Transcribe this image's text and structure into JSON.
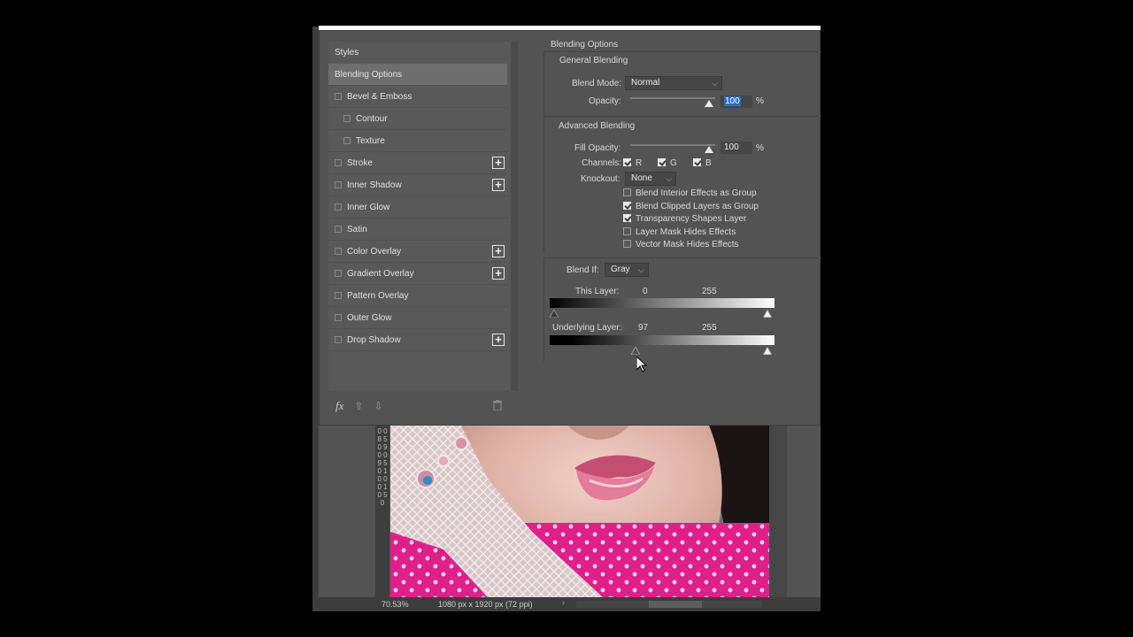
{
  "styles_panel": {
    "header": "Styles",
    "selected": "Blending Options",
    "items": [
      {
        "label": "Bevel & Emboss",
        "sub": false,
        "plus": false
      },
      {
        "label": "Contour",
        "sub": true,
        "plus": false
      },
      {
        "label": "Texture",
        "sub": true,
        "plus": false
      },
      {
        "label": "Stroke",
        "sub": false,
        "plus": true
      },
      {
        "label": "Inner Shadow",
        "sub": false,
        "plus": true
      },
      {
        "label": "Inner Glow",
        "sub": false,
        "plus": false
      },
      {
        "label": "Satin",
        "sub": false,
        "plus": false
      },
      {
        "label": "Color Overlay",
        "sub": false,
        "plus": true
      },
      {
        "label": "Gradient Overlay",
        "sub": false,
        "plus": true
      },
      {
        "label": "Pattern Overlay",
        "sub": false,
        "plus": false
      },
      {
        "label": "Outer Glow",
        "sub": false,
        "plus": false
      },
      {
        "label": "Drop Shadow",
        "sub": false,
        "plus": true
      }
    ],
    "footer": {
      "fx": "fx",
      "up": "⇧",
      "down": "⇩",
      "trash": "🗑"
    }
  },
  "blending_options": {
    "title": "Blending Options",
    "general": {
      "title": "General Blending",
      "blend_mode_label": "Blend Mode:",
      "blend_mode_value": "Normal",
      "opacity_label": "Opacity:",
      "opacity_value": "100",
      "opacity_unit": "%",
      "opacity_level": 1.0
    },
    "advanced": {
      "title": "Advanced Blending",
      "fill_opacity_label": "Fill Opacity:",
      "fill_opacity_value": "100",
      "fill_opacity_unit": "%",
      "fill_opacity_level": 1.0,
      "channels_label": "Channels:",
      "channels": [
        {
          "label": "R",
          "checked": true
        },
        {
          "label": "G",
          "checked": true
        },
        {
          "label": "B",
          "checked": true
        }
      ],
      "knockout_label": "Knockout:",
      "knockout_value": "None",
      "options": [
        {
          "label": "Blend Interior Effects as Group",
          "checked": false
        },
        {
          "label": "Blend Clipped Layers as Group",
          "checked": true
        },
        {
          "label": "Transparency Shapes Layer",
          "checked": true
        },
        {
          "label": "Layer Mask Hides Effects",
          "checked": false
        },
        {
          "label": "Vector Mask Hides Effects",
          "checked": false
        }
      ]
    },
    "blend_if": {
      "label": "Blend If:",
      "value": "Gray",
      "this_layer": {
        "label": "This Layer:",
        "low": "0",
        "high": "255",
        "low_level": 0,
        "high_level": 255
      },
      "underlying_layer": {
        "label": "Underlying Layer:",
        "low": "97",
        "high": "255",
        "low_level": 97,
        "high_level": 255
      }
    }
  },
  "status": {
    "zoom": "70.53%",
    "doc_info": "1080 px x 1920 px (72 ppi)",
    "arrow": "›"
  },
  "ruler_text": "0 0 8 5 0 9 0 0 9 5 0 1 0 0 0 1 0 5 0"
}
